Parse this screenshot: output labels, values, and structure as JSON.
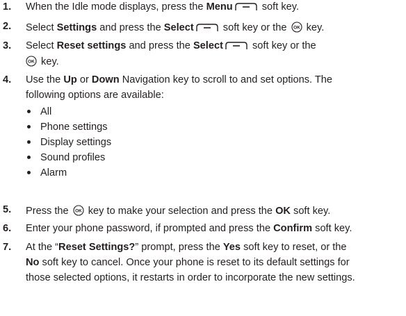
{
  "steps": [
    {
      "number": "1.",
      "lines": [
        {
          "t1": "When the Idle mode displays, press the ",
          "b1": "Menu",
          "t2": " soft key."
        }
      ]
    },
    {
      "number": "2.",
      "lines": [
        {
          "t1": "Select ",
          "b1": "Settings",
          "t2": " and press the ",
          "b2": "Select",
          "t3": " soft key or the ",
          "t4": " key."
        }
      ]
    },
    {
      "number": "3.",
      "lines": [
        {
          "t1": "Select ",
          "b1": "Reset settings",
          "t2": " and press the ",
          "b2": "Select",
          "t3": " soft key or the"
        },
        {
          "t1": " key."
        }
      ]
    },
    {
      "number": "4.",
      "lines": [
        {
          "t1": "Use the ",
          "b1": "Up",
          "t2": " or ",
          "b2": "Down",
          "t3": " Navigation key to scroll to and set options. The"
        },
        {
          "t1": "following options are available:"
        }
      ]
    },
    {
      "number": "5.",
      "lines": [
        {
          "t1": "Press the ",
          "t2": " key to make your selection and press the ",
          "b1": "OK",
          "t3": " soft key."
        }
      ]
    },
    {
      "number": "6.",
      "lines": [
        {
          "t1": "Enter your phone password, if prompted and press the ",
          "b1": "Confirm",
          "t2": " soft key."
        }
      ]
    },
    {
      "number": "7.",
      "lines": [
        {
          "t1": "At the “",
          "b1": "Reset Settings?",
          "t2": "” prompt, press the ",
          "b2": "Yes",
          "t3": " soft key to reset, or the"
        },
        {
          "b1": "No",
          "t1": " soft key to cancel. Once your phone is reset to its default settings for"
        },
        {
          "t1": "those selected options, it restarts in order to incorporate the new settings."
        }
      ]
    }
  ],
  "options": [
    "All",
    "Phone settings",
    "Display settings",
    "Sound profiles",
    "Alarm"
  ],
  "icons": {
    "soft_key": "soft-key-icon",
    "ok_key": "ok-key-icon"
  },
  "colors": {
    "text": "#231f20"
  }
}
